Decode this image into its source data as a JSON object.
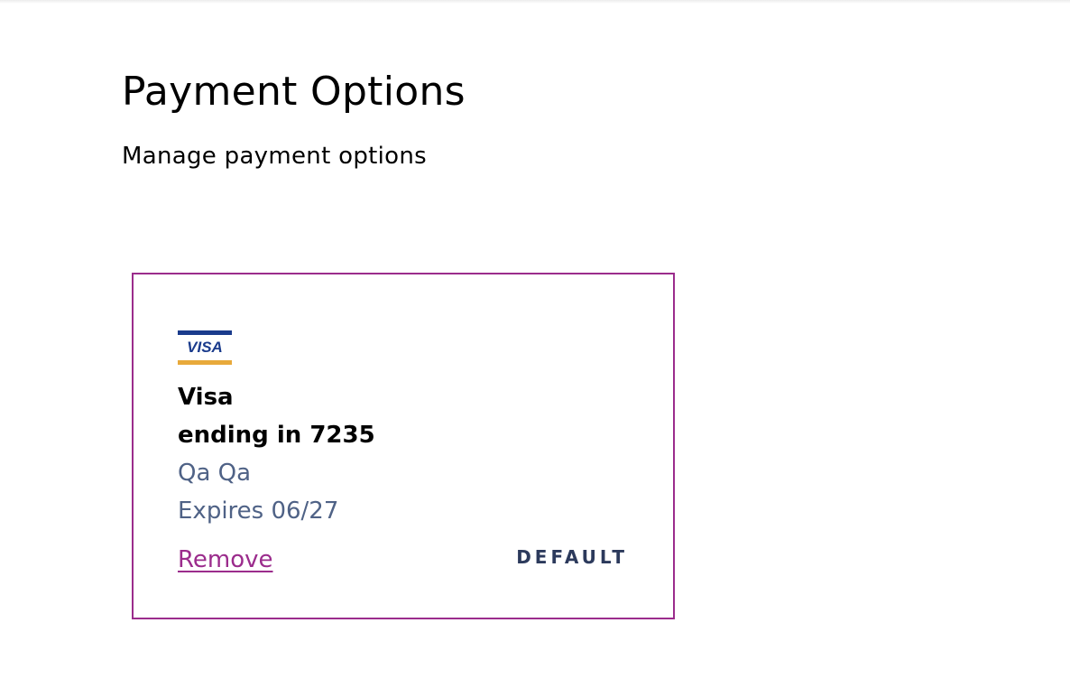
{
  "page": {
    "title": "Payment Options",
    "subtitle": "Manage payment options"
  },
  "payment_card": {
    "logo_text": "VISA",
    "logo_icon": "visa-logo",
    "brand": "Visa",
    "ending": "ending in 7235",
    "holder": "Qa Qa",
    "expiry": "Expires 06/27",
    "remove_label": "Remove",
    "default_label": "DEFAULT"
  },
  "colors": {
    "accent": "#9b2c8c",
    "muted_text": "#4f6286",
    "badge_text": "#2c3a5c",
    "visa_blue": "#1a3b8c",
    "visa_gold": "#e8a93b"
  }
}
